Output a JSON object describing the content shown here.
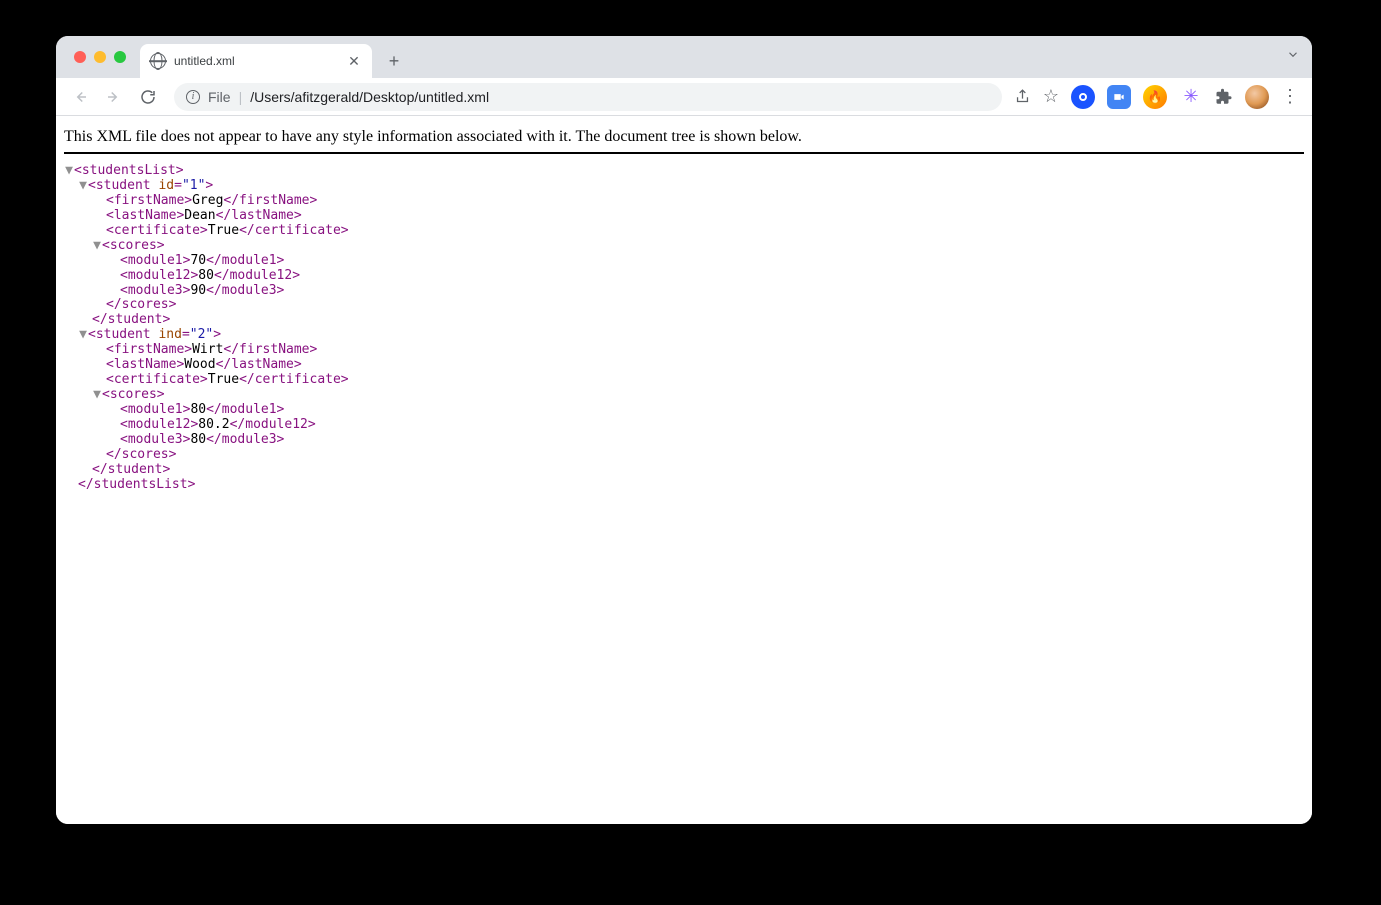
{
  "tab": {
    "title": "untitled.xml"
  },
  "address": {
    "scheme_label": "File",
    "path": "/Users/afitzgerald/Desktop/untitled.xml"
  },
  "notice": "This XML file does not appear to have any style information associated with it. The document tree is shown below.",
  "xml": {
    "root_open": "studentsList",
    "root_close": "studentsList",
    "students": [
      {
        "tag": "student",
        "attr_name": "id",
        "attr_val": "1",
        "firstName": "Greg",
        "lastName": "Dean",
        "certificate": "True",
        "scores_tag": "scores",
        "scores": [
          {
            "tag": "module1",
            "val": "70"
          },
          {
            "tag": "module12",
            "val": "80"
          },
          {
            "tag": "module3",
            "val": "90"
          }
        ]
      },
      {
        "tag": "student",
        "attr_name": "ind",
        "attr_val": "2",
        "firstName": "Wirt",
        "lastName": "Wood",
        "certificate": "True",
        "scores_tag": "scores",
        "scores": [
          {
            "tag": "module1",
            "val": "80"
          },
          {
            "tag": "module12",
            "val": "80.2"
          },
          {
            "tag": "module3",
            "val": "80"
          }
        ]
      }
    ],
    "labels": {
      "firstName": "firstName",
      "lastName": "lastName",
      "certificate": "certificate"
    }
  }
}
